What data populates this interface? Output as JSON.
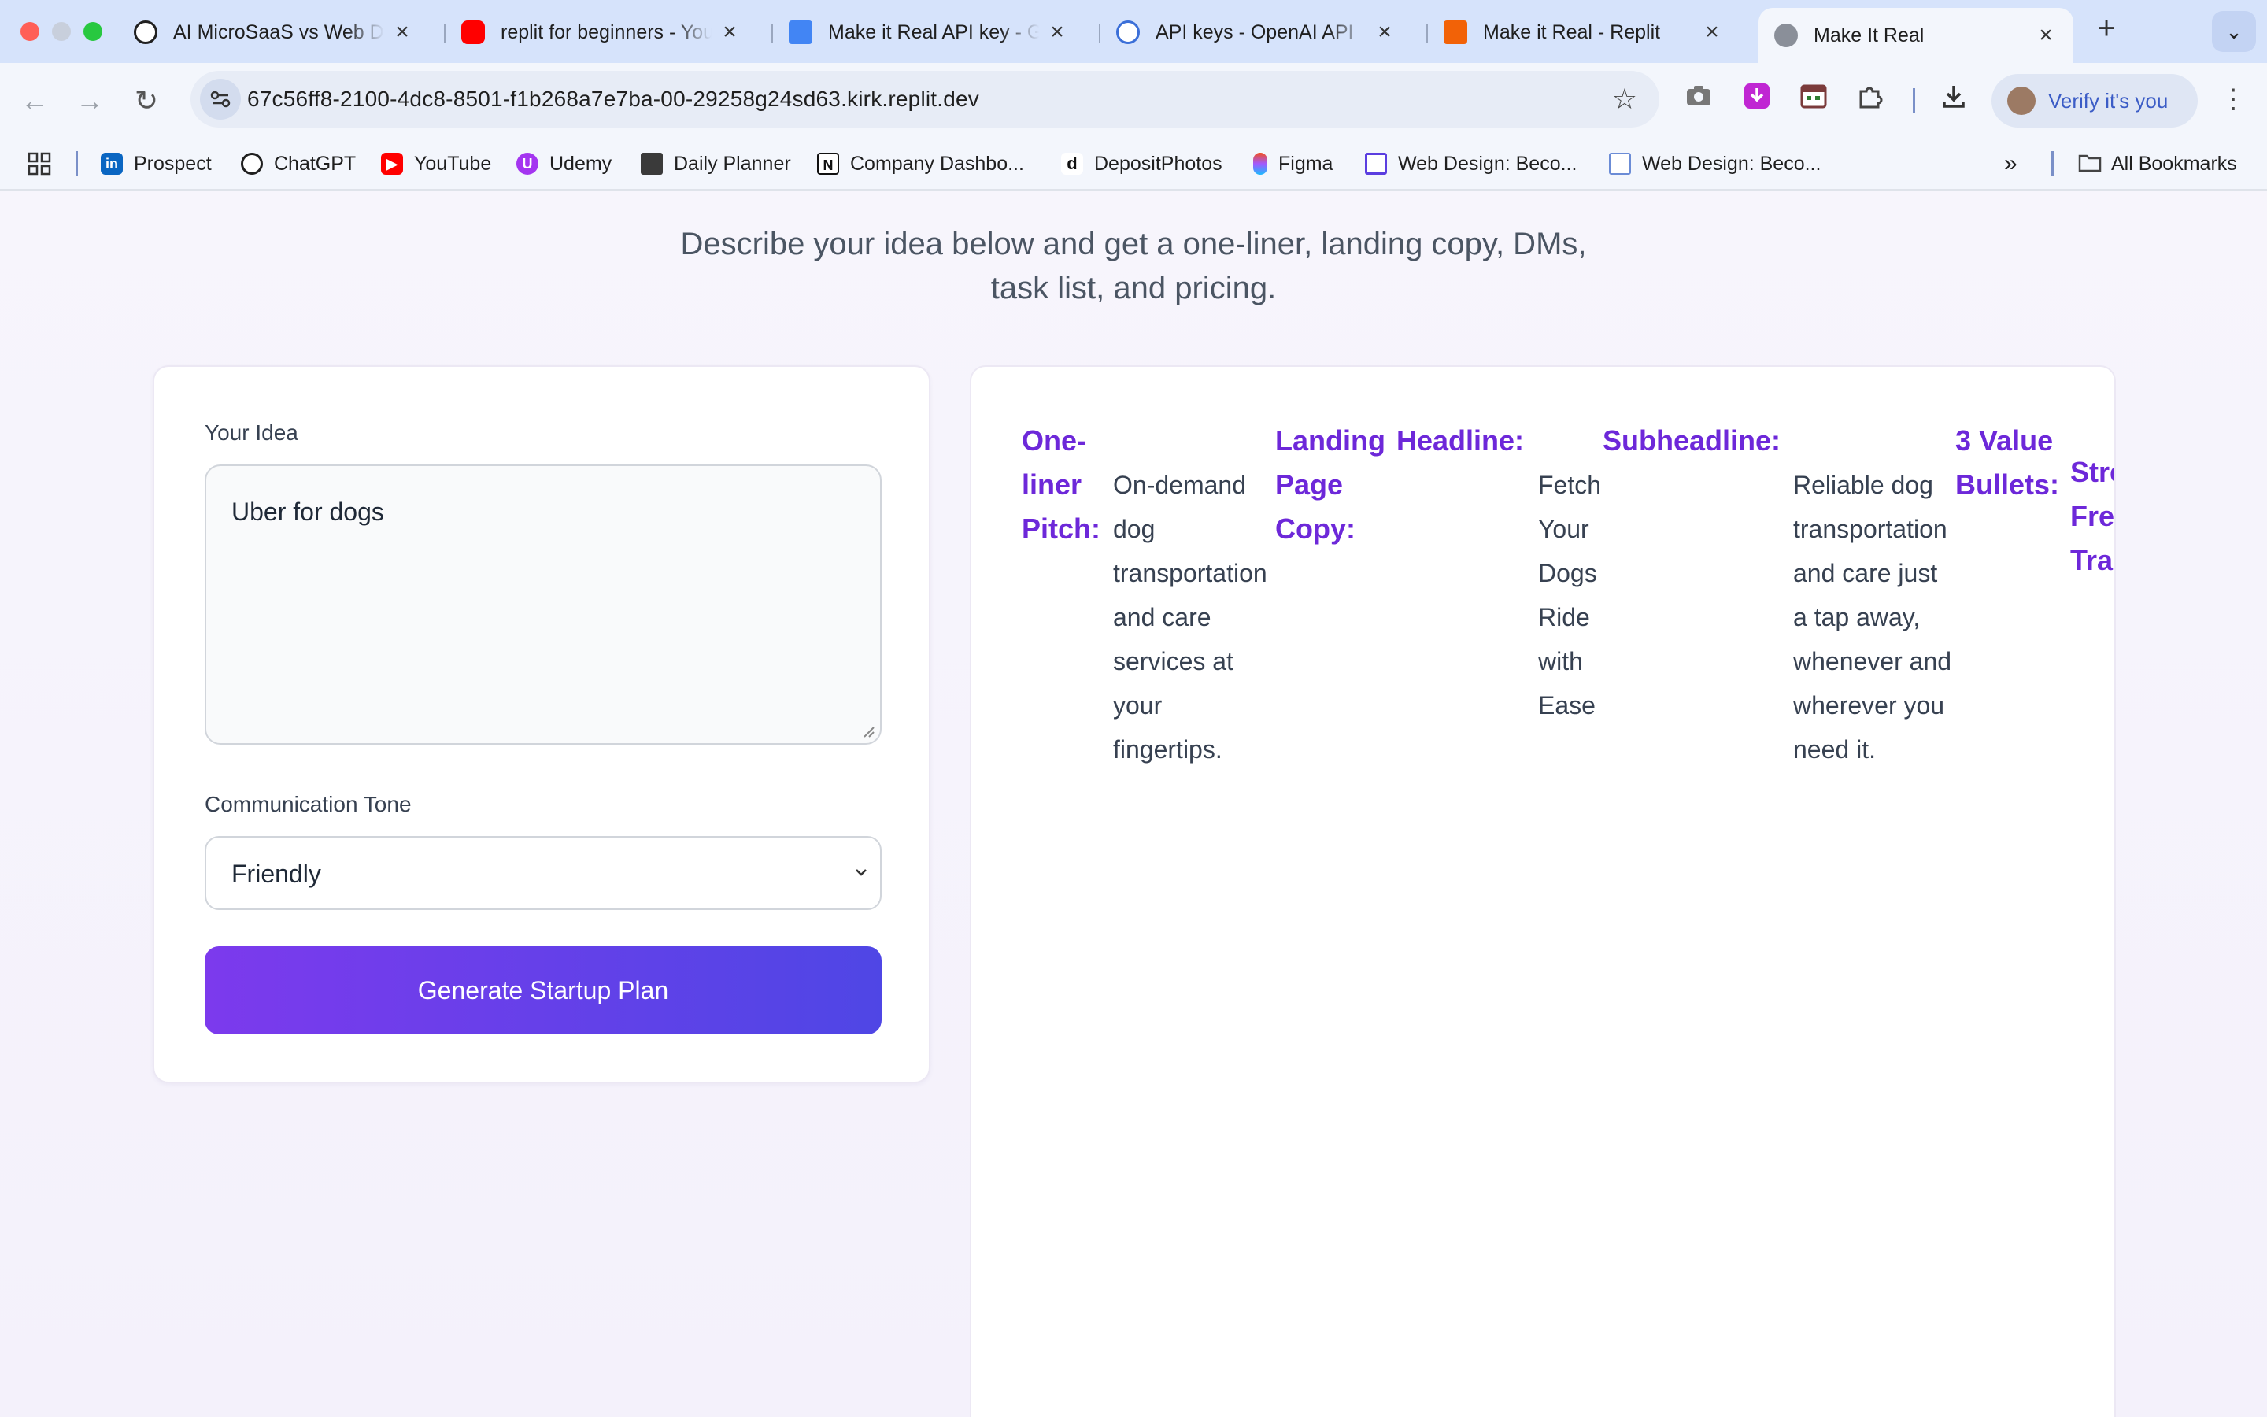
{
  "browser": {
    "tabs": [
      {
        "title": "AI MicroSaaS vs Web De",
        "favicon": "chatgpt-icon",
        "favicon_color": "#202020"
      },
      {
        "title": "replit for beginners - You",
        "favicon": "youtube-icon",
        "favicon_color": "#ff0000"
      },
      {
        "title": "Make it Real API key - G",
        "favicon": "google-docs-icon",
        "favicon_color": "#4285f4"
      },
      {
        "title": "API keys - OpenAI API",
        "favicon": "openai-icon",
        "favicon_color": "#3b6fd8"
      },
      {
        "title": "Make it Real - Replit",
        "favicon": "replit-icon",
        "favicon_color": "#f26207"
      },
      {
        "title": "Make It Real",
        "favicon": "globe-icon",
        "favicon_color": "#8a8f99"
      }
    ],
    "url": "67c56ff8-2100-4dc8-8501-f1b268a7e7ba-00-29258g24sd63.kirk.replit.dev",
    "verify_label": "Verify it's you",
    "bookmarks": [
      {
        "label": "Prospect",
        "icon": "linkedin-icon",
        "color": "#0a66c2"
      },
      {
        "label": "ChatGPT",
        "icon": "chatgpt-icon",
        "color": "#202020"
      },
      {
        "label": "YouTube",
        "icon": "youtube-icon",
        "color": "#ff0000"
      },
      {
        "label": "Udemy",
        "icon": "udemy-icon",
        "color": "#a435f0"
      },
      {
        "label": "Daily Planner",
        "icon": "notebook-icon",
        "color": "#3a3a3a"
      },
      {
        "label": "Company Dashbo...",
        "icon": "notion-icon",
        "color": "#111111"
      },
      {
        "label": "DepositPhotos",
        "icon": "depositphotos-icon",
        "color": "#111111"
      },
      {
        "label": "Figma",
        "icon": "figma-icon",
        "color": "#f24e1e"
      },
      {
        "label": "Web Design: Beco...",
        "icon": "framer-icon",
        "color": "#5b3ee0"
      },
      {
        "label": "Web Design: Beco...",
        "icon": "webpage-icon",
        "color": "#6b8cd6"
      }
    ],
    "all_bookmarks_label": "All Bookmarks"
  },
  "page": {
    "intro_line1": "Describe your idea below and get a one-liner, landing copy, DMs,",
    "intro_line2": "task list, and pricing.",
    "form": {
      "idea_label": "Your Idea",
      "idea_value": "Uber for dogs",
      "tone_label": "Communication Tone",
      "tone_value": "Friendly",
      "generate_label": "Generate Startup Plan"
    },
    "result": {
      "one_liner_heading": [
        "One-",
        "liner",
        "Pitch:"
      ],
      "one_liner_body": [
        "On-demand",
        "dog",
        "transportation",
        "and care",
        "services at",
        "your",
        "fingertips."
      ],
      "landing_heading": [
        "Landing",
        "Page",
        "Copy:"
      ],
      "headline_heading": [
        "Headline:"
      ],
      "headline_body": [
        "Fetch",
        "Your",
        "Dogs",
        "Ride",
        "with",
        "Ease"
      ],
      "subheadline_heading": [
        "Subheadline:"
      ],
      "subheadline_body": [
        "Reliable dog",
        "transportation",
        "and care just",
        "a tap away,",
        "whenever and",
        "wherever you",
        "need it."
      ],
      "bullets_heading": [
        "3 Value",
        "Bullets:"
      ],
      "bullets_body_partial": [
        "Stre",
        "Fre",
        "Tra"
      ]
    },
    "accent_color": "#6d28d9",
    "button_gradient": [
      "#7c3aed",
      "#4f46e5"
    ]
  }
}
